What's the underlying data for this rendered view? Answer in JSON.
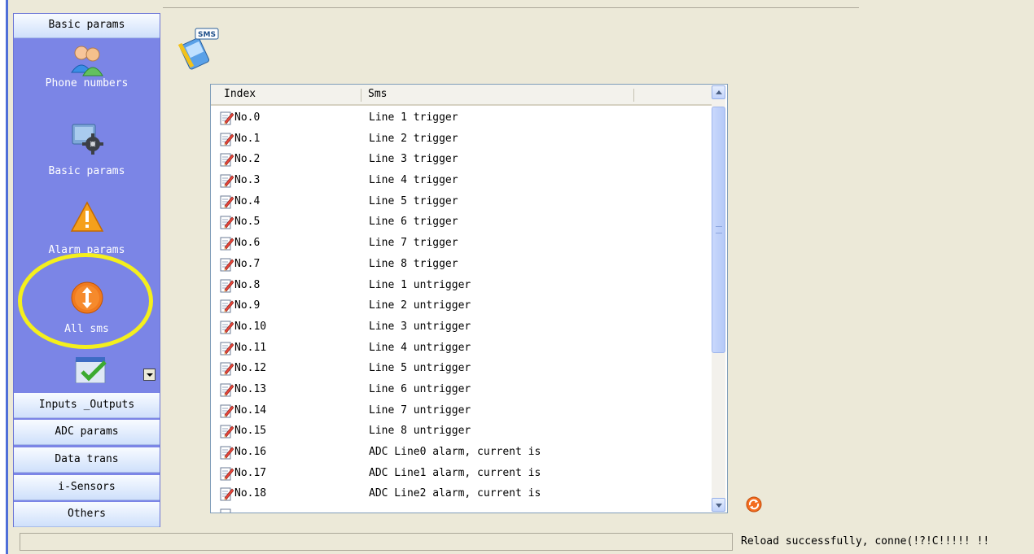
{
  "sidebar": {
    "active_group": "Basic params",
    "items": [
      {
        "label": "Phone numbers",
        "icon": "users-icon"
      },
      {
        "label": "Basic params",
        "icon": "settings-gear-icon"
      },
      {
        "label": "Alarm params",
        "icon": "warning-icon"
      },
      {
        "label": "All sms",
        "icon": "sms-arrows-icon"
      }
    ],
    "partial_item_icon": "calendar-check-icon",
    "groups": [
      "Inputs _Outputs",
      "ADC params",
      "Data trans",
      "i-Sensors",
      "Others"
    ]
  },
  "header_icon": "sms-phone-icon",
  "list": {
    "columns": {
      "index": "Index",
      "sms": "Sms"
    },
    "rows": [
      {
        "index": "No.0",
        "sms": "Line 1 trigger"
      },
      {
        "index": "No.1",
        "sms": "Line 2 trigger"
      },
      {
        "index": "No.2",
        "sms": "Line 3 trigger"
      },
      {
        "index": "No.3",
        "sms": "Line 4 trigger"
      },
      {
        "index": "No.4",
        "sms": "Line 5 trigger"
      },
      {
        "index": "No.5",
        "sms": "Line 6 trigger"
      },
      {
        "index": "No.6",
        "sms": "Line 7 trigger"
      },
      {
        "index": "No.7",
        "sms": "Line 8 trigger"
      },
      {
        "index": "No.8",
        "sms": "Line 1 untrigger"
      },
      {
        "index": "No.9",
        "sms": "Line 2 untrigger"
      },
      {
        "index": "No.10",
        "sms": "Line 3 untrigger"
      },
      {
        "index": "No.11",
        "sms": "Line 4 untrigger"
      },
      {
        "index": "No.12",
        "sms": "Line 5 untrigger"
      },
      {
        "index": "No.13",
        "sms": "Line 6 untrigger"
      },
      {
        "index": "No.14",
        "sms": "Line 7 untrigger"
      },
      {
        "index": "No.15",
        "sms": "Line 8 untrigger"
      },
      {
        "index": "No.16",
        "sms": "ADC Line0 alarm, current is"
      },
      {
        "index": "No.17",
        "sms": "ADC Line1 alarm, current is"
      },
      {
        "index": "No.18",
        "sms": "ADC Line2 alarm, current is"
      }
    ]
  },
  "refresh_icon": "refresh-icon",
  "status": {
    "text": "Reload successfully, conne(!?!C!!!!! !!"
  },
  "colors": {
    "sidebar_bg": "#7b85e6",
    "highlight": "#f4ef1d",
    "window_bg": "#ece9d8"
  }
}
